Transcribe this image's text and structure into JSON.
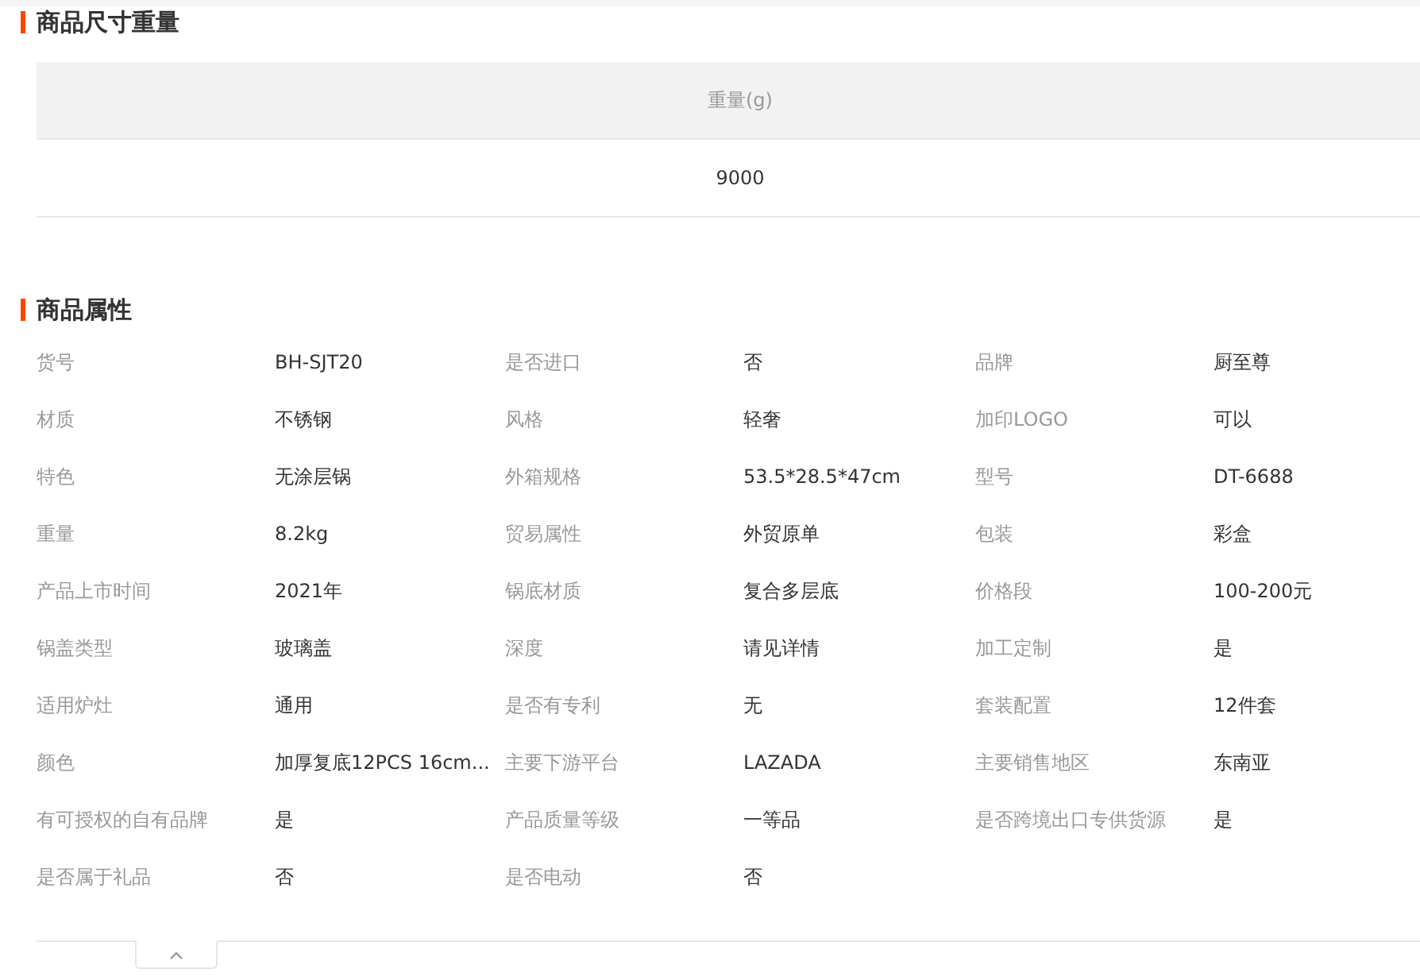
{
  "size_weight": {
    "title": "商品尺寸重量",
    "columns": [
      "重量(g)"
    ],
    "rows": [
      [
        "9000"
      ]
    ]
  },
  "attributes": {
    "title": "商品属性",
    "items": [
      {
        "label": "货号",
        "value": "BH-SJT20"
      },
      {
        "label": "是否进口",
        "value": "否"
      },
      {
        "label": "品牌",
        "value": "厨至尊"
      },
      {
        "label": "材质",
        "value": "不锈钢"
      },
      {
        "label": "风格",
        "value": "轻奢"
      },
      {
        "label": "加印LOGO",
        "value": "可以"
      },
      {
        "label": "特色",
        "value": "无涂层锅"
      },
      {
        "label": "外箱规格",
        "value": "53.5*28.5*47cm"
      },
      {
        "label": "型号",
        "value": "DT-6688"
      },
      {
        "label": "重量",
        "value": "8.2kg"
      },
      {
        "label": "贸易属性",
        "value": "外贸原单"
      },
      {
        "label": "包装",
        "value": "彩盒"
      },
      {
        "label": "产品上市时间",
        "value": "2021年"
      },
      {
        "label": "锅底材质",
        "value": "复合多层底"
      },
      {
        "label": "价格段",
        "value": "100-200元"
      },
      {
        "label": "锅盖类型",
        "value": "玻璃盖"
      },
      {
        "label": "深度",
        "value": "请见详情"
      },
      {
        "label": "加工定制",
        "value": "是"
      },
      {
        "label": "适用炉灶",
        "value": "通用"
      },
      {
        "label": "是否有专利",
        "value": "无"
      },
      {
        "label": "套装配置",
        "value": "12件套"
      },
      {
        "label": "颜色",
        "value": "加厚复底12PCS 16cm..."
      },
      {
        "label": "主要下游平台",
        "value": "LAZADA"
      },
      {
        "label": "主要销售地区",
        "value": "东南亚"
      },
      {
        "label": "有可授权的自有品牌",
        "value": "是"
      },
      {
        "label": "产品质量等级",
        "value": "一等品"
      },
      {
        "label": "是否跨境出口专供货源",
        "value": "是"
      },
      {
        "label": "是否属于礼品",
        "value": "否"
      },
      {
        "label": "是否电动",
        "value": "否"
      }
    ]
  }
}
